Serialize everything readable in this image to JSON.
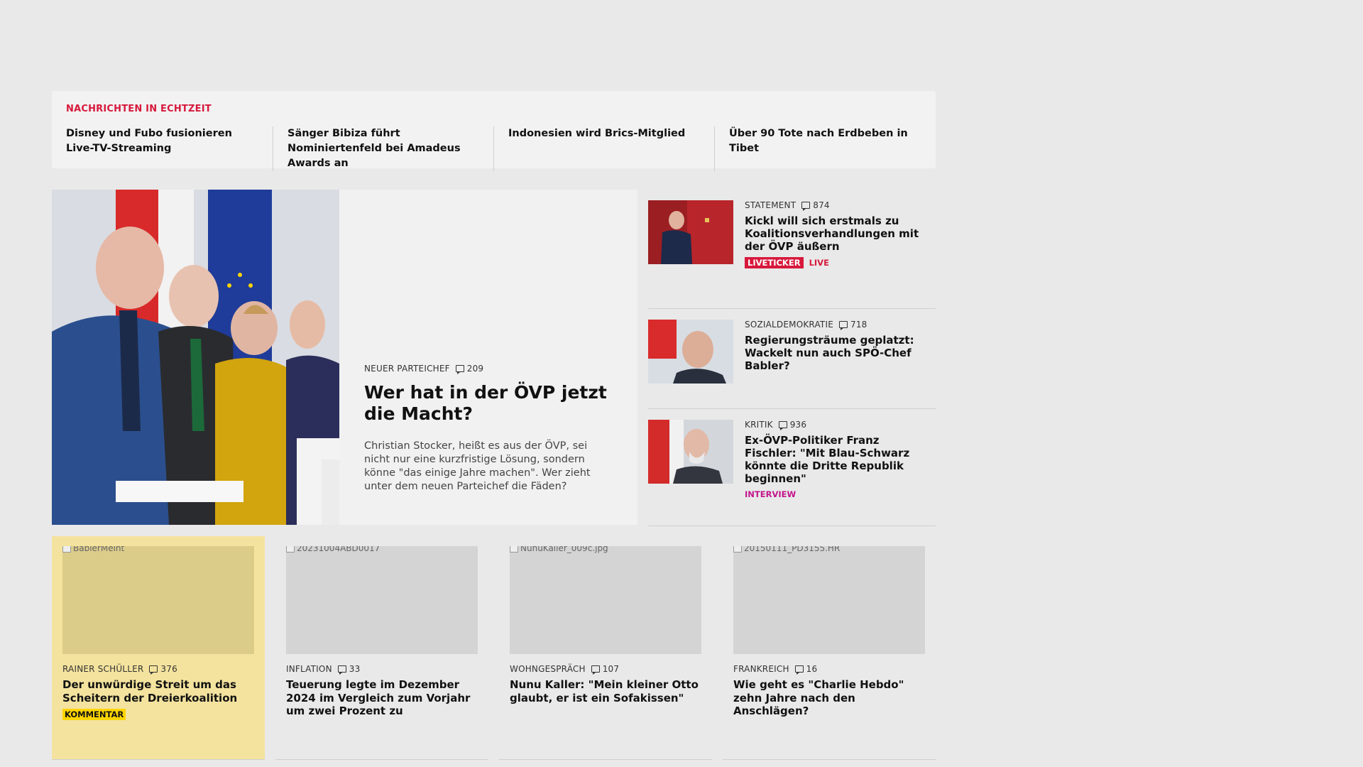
{
  "ticker": {
    "label": "NACHRICHTEN IN ECHTZEIT",
    "items": [
      "Disney und Fubo fusionieren Live-TV-Streaming",
      "Sänger Bibiza führt Nominiertenfeld bei Amadeus Awards an",
      "Indonesien wird Brics-Mitglied",
      "Über 90 Tote nach Erdbeben in Tibet"
    ]
  },
  "hero": {
    "kicker": "NEUER PARTEICHEF",
    "comments": "209",
    "title": "Wer hat in der ÖVP jetzt die Macht?",
    "teaser": "Christian Stocker, heißt es aus der ÖVP, sei nicht nur eine kurzfristige Lösung, sondern könne \"das einige Jahre machen\". Wer zieht unter dem neuen Parteichef die Fäden?"
  },
  "side": [
    {
      "kicker": "STATEMENT",
      "comments": "874",
      "title": "Kickl will sich erstmals zu Koali­tionsverhandlungen mit der ÖVP äußern",
      "tag_box": "LIVETICKER",
      "tag_live": "LIVE"
    },
    {
      "kicker": "SOZIALDEMOKRATIE",
      "comments": "718",
      "title": "Regierungsträume geplatzt: Wackelt nun auch SPÖ-Chef Babler?"
    },
    {
      "kicker": "KRITIK",
      "comments": "936",
      "title": "Ex-ÖVP-Politiker Franz Fischler: \"Mit Blau-Schwarz könnte die Dritte Republik beginnen\"",
      "tag": "INTERVIEW"
    }
  ],
  "cards": [
    {
      "img_alt": "BablerMeint",
      "kicker": "RAINER SCHÜLLER",
      "comments": "376",
      "title": "Der unwürdige Streit um das Scheitern der Dreierkoalition",
      "tag": "KOMMENTAR"
    },
    {
      "img_alt": "20231004ABD0017",
      "kicker": "INFLATION",
      "comments": "33",
      "title": "Teuerung legte im Dezember 2024 im Vergleich zum Vorjahr um zwei Prozent zu"
    },
    {
      "img_alt": "NunuKaller_009c.jpg",
      "kicker": "WOHNGESPRÄCH",
      "comments": "107",
      "title": "Nunu Kaller: \"Mein kleiner Otto glaubt, er ist ein Sofakissen\""
    },
    {
      "img_alt": "20150111_PD3155.HR",
      "kicker": "FRANKREICH",
      "comments": "16",
      "title": "Wie geht es \"Charlie Hebdo\" zehn Jahre nach den Anschlägen?"
    }
  ],
  "colors": {
    "accent_red": "#d7193c",
    "interview_magenta": "#c2158c",
    "kommentar_yellow": "#ffd500",
    "highlight_card": "#f4e39e"
  }
}
